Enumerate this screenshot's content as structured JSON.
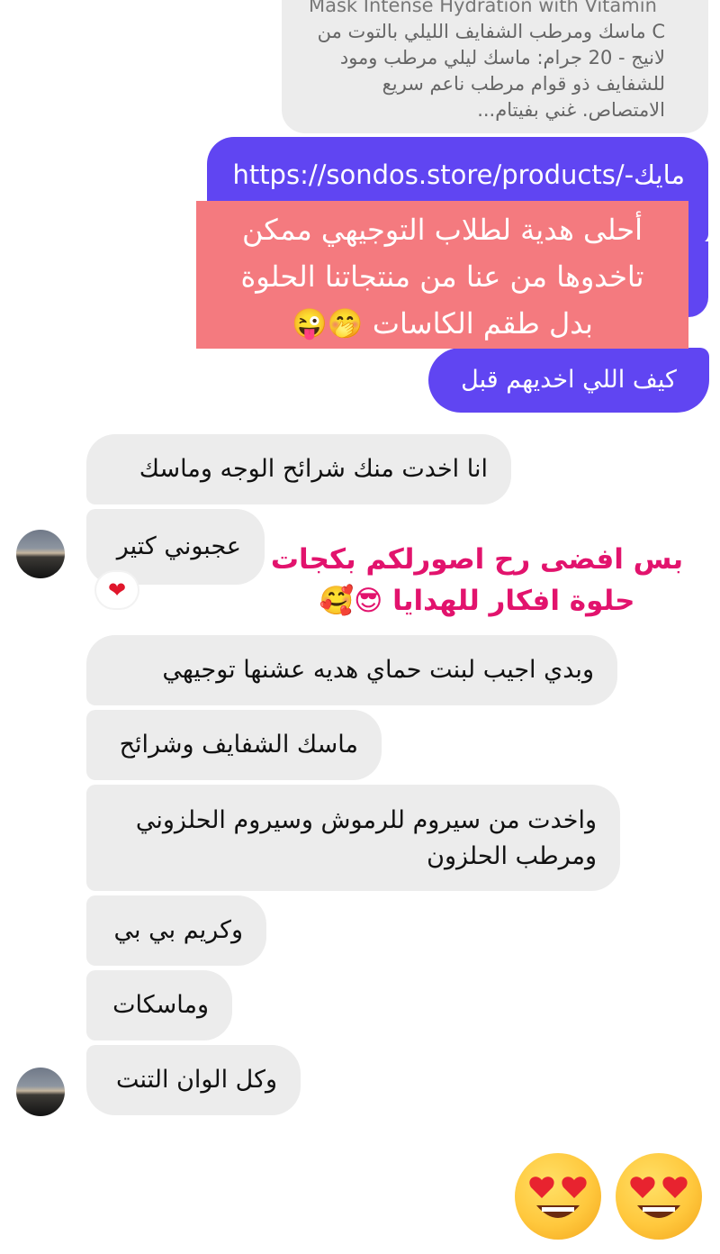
{
  "link_card": {
    "title_en": "Mask Intense Hydration with Vitamin",
    "description": "C ماسك ومرطب الشفايف الليلي بالتوت من لانيج - 20 جرام: ماسك ليلي مرطب ومود للشفايف ذو قوام مرطب ناعم سريع الامتصاص. غني بفيتام..."
  },
  "outgoing": {
    "url_message": "مايك-/https://sondos.store/products",
    "question": "كيف اللي اخديهم قبل"
  },
  "overlay_caption": {
    "line1": "أحلى هدية لطلاب التوجيهي ممكن",
    "line2": "تاخدوها من عنا من منتجاتنا الحلوة",
    "line3": "بدل طقم الكاسات 🤭😜"
  },
  "incoming": [
    "انا اخدت منك شرائح الوجه وماسك",
    "عجبوني كتير",
    "وبدي اجيب لبنت حماي هديه عشنها توجيهي",
    "ماسك الشفايف وشرائح",
    "واخدت من سيروم للرموش وسيروم الحلزوني ومرطب الحلزون",
    "وكريم بي بي",
    "وماسكات",
    "وكل الوان التنت"
  ],
  "reaction": "❤",
  "pink_overlay": {
    "line1": "بس افضى رح اصورلكم  بكجات",
    "line2": "حلوة افكار للهدايا 😎🥰"
  },
  "colors": {
    "outgoing_bubble": "#6045f2",
    "incoming_bubble": "#ececec",
    "caption_box": "#f47a7f",
    "pink_text": "#e2136d"
  }
}
